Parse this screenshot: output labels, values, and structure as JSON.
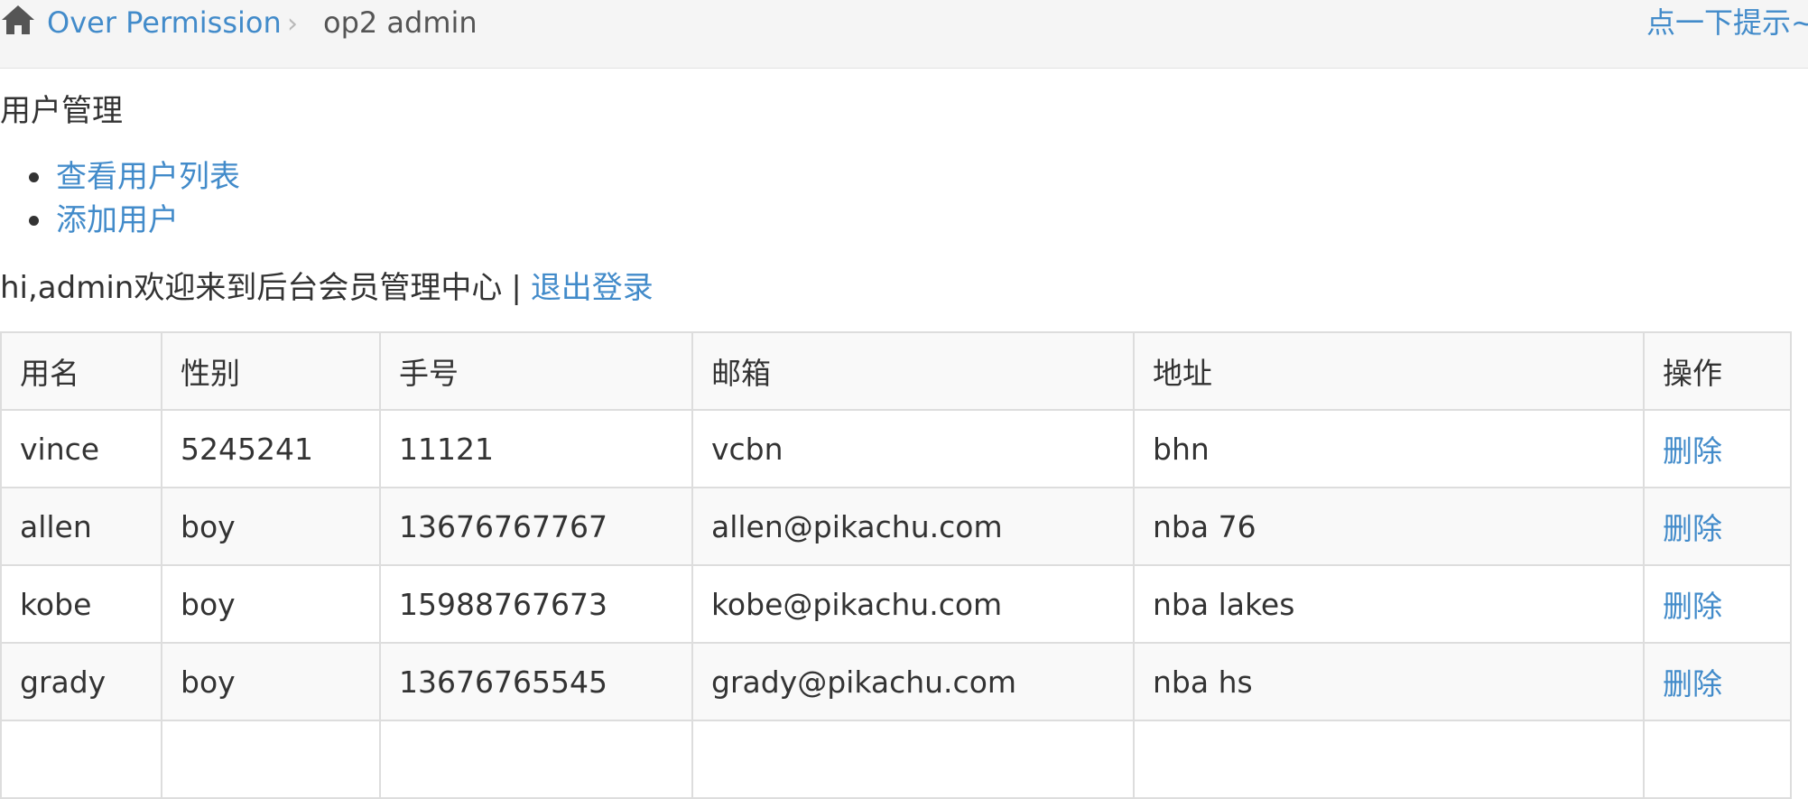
{
  "breadcrumb": {
    "home_icon": "home-icon",
    "section_link": "Over Permission",
    "separator": "›",
    "current": "op2 admin"
  },
  "tip_link": "点一下提示~",
  "section_title": "用户管理",
  "menu": {
    "items": [
      {
        "label": "查看用户列表"
      },
      {
        "label": "添加用户"
      }
    ]
  },
  "welcome": {
    "text": "hi,admin欢迎来到后台会员管理中心",
    "separator": "|",
    "logout": "退出登录"
  },
  "table": {
    "headers": [
      "用名",
      "性别",
      "手号",
      "邮箱",
      "地址",
      "操作"
    ],
    "rows": [
      {
        "username": "vince",
        "sex": "5245241",
        "phone": "11121",
        "email": "vcbn",
        "address": "bhn",
        "action": "删除"
      },
      {
        "username": "allen",
        "sex": "boy",
        "phone": "13676767767",
        "email": "allen@pikachu.com",
        "address": "nba 76",
        "action": "删除"
      },
      {
        "username": "kobe",
        "sex": "boy",
        "phone": "15988767673",
        "email": "kobe@pikachu.com",
        "address": "nba lakes",
        "action": "删除"
      },
      {
        "username": "grady",
        "sex": "boy",
        "phone": "13676765545",
        "email": "grady@pikachu.com",
        "address": "nba hs",
        "action": "删除"
      },
      {
        "username": "",
        "sex": "",
        "phone": "",
        "email": "",
        "address": "",
        "action": ""
      }
    ]
  },
  "colors": {
    "link": "#428bca",
    "topbar_bg": "#f5f5f5",
    "table_border": "#dddddd",
    "stripe_bg": "#f9f9f9"
  }
}
